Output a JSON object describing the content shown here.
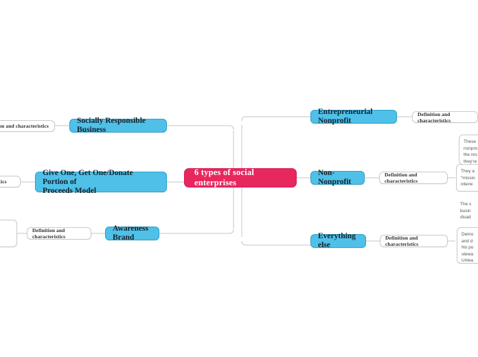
{
  "diagram": {
    "type": "mind-map",
    "background": "#ffffff",
    "colors": {
      "root_fill": "#E8275E",
      "root_text": "#ffffff",
      "topic_fill": "#4FC1E9",
      "topic_border": "#2e9fc9",
      "topic_text": "#14212b",
      "sub_fill": "#ffffff",
      "sub_border": "#c9c9c9",
      "connector": "#c4c4c4",
      "detail_text": "#555555"
    },
    "root": {
      "label": "6 types of social enterprises"
    },
    "branches_right": [
      {
        "label": "Entrepreneurial Nonprofit",
        "sub_label": "Definition and characteristics",
        "detail_lines": [
          "These",
          "nonpro",
          "the res",
          "they're"
        ]
      },
      {
        "label": "Non-Nonprofit",
        "sub_label": "Definition and characteristics",
        "detail_lines": [
          "They a",
          "\"missio",
          "interw"
        ]
      },
      {
        "label": "Everything else",
        "sub_label": "Definition and characteristics",
        "detail_lines": [
          "Demo",
          "and d",
          "No po",
          "stewa",
          "Unlea"
        ]
      }
    ],
    "branches_left": [
      {
        "label": "Socially Responsible Business",
        "sub_label": "nition and characteristics"
      },
      {
        "label": "Give One, Get One/Donate Portion of Proceeds Model",
        "label_line1": "Give One, Get One/Donate Portion of",
        "label_line2": "Proceeds Model",
        "sub_label": "cteristics"
      },
      {
        "label": "Awareness Brand",
        "sub_label": "Definition and characteristics",
        "extra_sub_label": ""
      }
    ],
    "floating_text": {
      "lines": [
        "The s",
        "busin",
        "disad"
      ]
    }
  }
}
